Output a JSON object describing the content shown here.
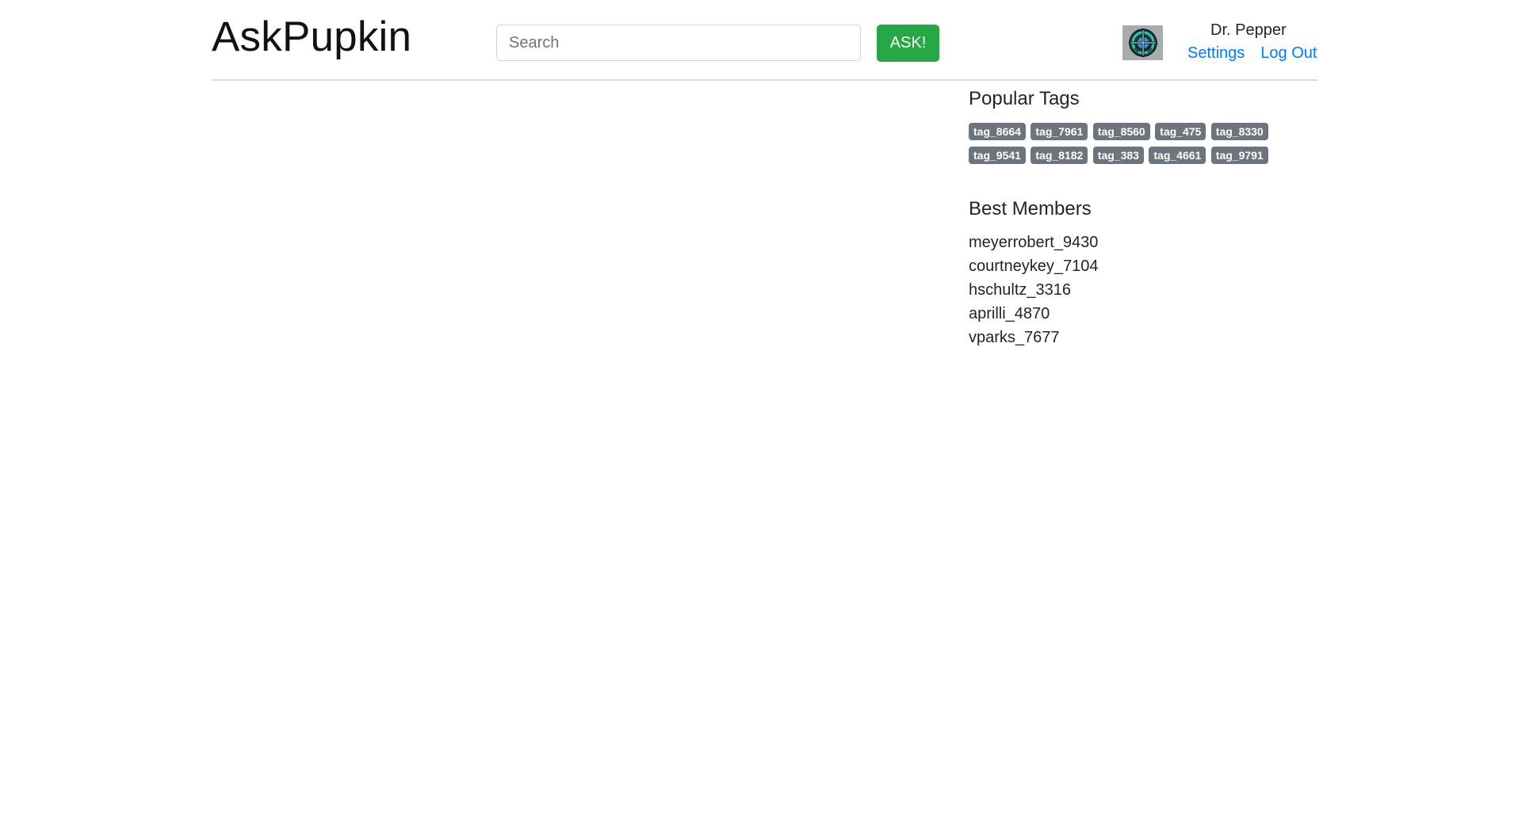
{
  "header": {
    "brand": "AskPupkin",
    "search_placeholder": "Search",
    "ask_label": "ASK!",
    "user_name": "Dr. Pepper",
    "settings_label": "Settings",
    "logout_label": "Log Out",
    "avatar_icon": "crosshair-globe-icon"
  },
  "sidebar": {
    "popular_tags_title": "Popular Tags",
    "tags": [
      "tag_8664",
      "tag_7961",
      "tag_8560",
      "tag_475",
      "tag_8330",
      "tag_9541",
      "tag_8182",
      "tag_383",
      "tag_4661",
      "tag_9791"
    ],
    "best_members_title": "Best Members",
    "members": [
      "meyerrobert_9430",
      "courtneykey_7104",
      "hschultz_3316",
      "aprilli_4870",
      "vparks_7677"
    ]
  },
  "colors": {
    "ask_button": "#28a745",
    "link": "#007bff",
    "tag_badge": "#6c757d"
  }
}
